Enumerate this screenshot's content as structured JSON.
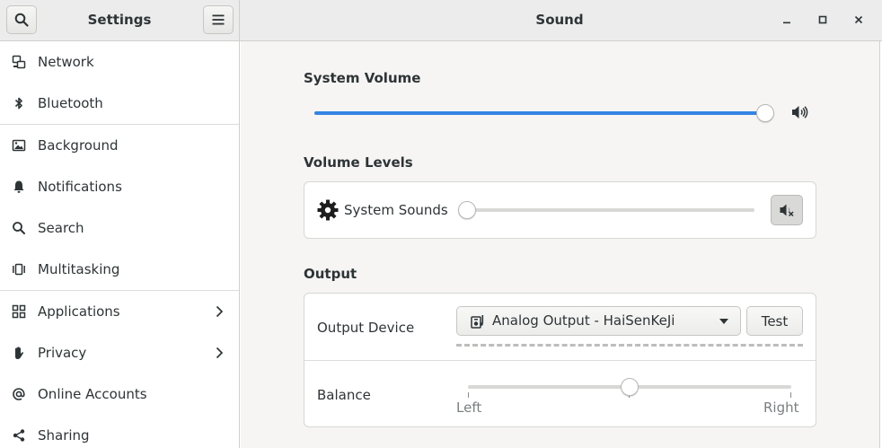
{
  "header": {
    "sidebar_title": "Settings",
    "panel_title": "Sound"
  },
  "sidebar": {
    "items": [
      {
        "label": "Network",
        "icon": "network-icon"
      },
      {
        "label": "Bluetooth",
        "icon": "bluetooth-icon"
      },
      {
        "label": "Background",
        "icon": "background-icon"
      },
      {
        "label": "Notifications",
        "icon": "bell-icon"
      },
      {
        "label": "Search",
        "icon": "search-icon"
      },
      {
        "label": "Multitasking",
        "icon": "multitasking-icon"
      },
      {
        "label": "Applications",
        "icon": "grid-icon",
        "has_submenu": true
      },
      {
        "label": "Privacy",
        "icon": "hand-icon",
        "has_submenu": true
      },
      {
        "label": "Online Accounts",
        "icon": "at-icon"
      },
      {
        "label": "Sharing",
        "icon": "share-icon"
      }
    ]
  },
  "sound": {
    "system_volume": {
      "title": "System Volume",
      "level": 1.0
    },
    "volume_levels": {
      "title": "Volume Levels",
      "system_sounds_label": "System Sounds",
      "system_sounds_level": 0.0,
      "muted": true
    },
    "output": {
      "title": "Output",
      "device_label": "Output Device",
      "device_value": "Analog Output - HaiSenKeJi",
      "test_label": "Test",
      "balance_label": "Balance",
      "balance_left": "Left",
      "balance_right": "Right",
      "balance_level": 0.5
    }
  },
  "colors": {
    "accent": "#3584e4",
    "sidebar_bg": "#ffffff",
    "content_bg": "#f6f5f4",
    "header_bg": "#ececec"
  }
}
